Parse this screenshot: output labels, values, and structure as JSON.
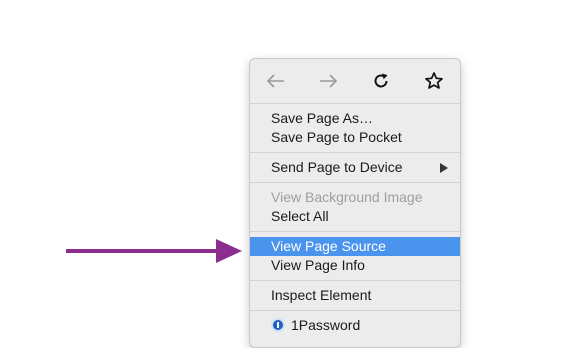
{
  "colors": {
    "annotation_arrow": "#8b2d8f",
    "selected_bg": "#4b94ee",
    "menu_bg": "#ececec",
    "disabled_text": "#9e9e9e"
  },
  "nav": {
    "back_icon": "arrow-left-icon",
    "forward_icon": "arrow-right-icon",
    "reload_icon": "reload-icon",
    "bookmark_icon": "star-icon"
  },
  "menu": {
    "save_page_as": "Save Page As…",
    "save_page_to_pocket": "Save Page to Pocket",
    "send_page_to_device": "Send Page to Device",
    "view_background_image": "View Background Image",
    "select_all": "Select All",
    "view_page_source": "View Page Source",
    "view_page_info": "View Page Info",
    "inspect_element": "Inspect Element",
    "onepassword": "1Password"
  }
}
